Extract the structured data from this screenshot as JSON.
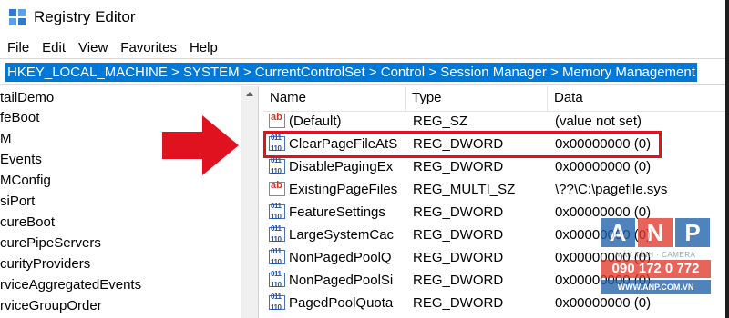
{
  "window": {
    "title": "Registry Editor",
    "icon": "registry-editor-icon"
  },
  "menu": [
    "File",
    "Edit",
    "View",
    "Favorites",
    "Help"
  ],
  "address": "HKEY_LOCAL_MACHINE > SYSTEM > CurrentControlSet > Control > Session Manager > Memory Management",
  "tree": [
    "tailDemo",
    "feBoot",
    "M",
    "Events",
    "MConfig",
    "siPort",
    "cureBoot",
    "curePipeServers",
    "curityProviders",
    "rviceAggregatedEvents",
    "rviceGroupOrder"
  ],
  "list": {
    "headers": {
      "name": "Name",
      "type": "Type",
      "data": "Data"
    },
    "rows": [
      {
        "icon": "string-value-icon",
        "name": "(Default)",
        "type": "REG_SZ",
        "data": "(value not set)"
      },
      {
        "icon": "dword-value-icon",
        "name": "ClearPageFileAtS",
        "type": "REG_DWORD",
        "data": "0x00000000 (0)"
      },
      {
        "icon": "dword-value-icon",
        "name": "DisablePagingEx",
        "type": "REG_DWORD",
        "data": "0x00000000 (0)"
      },
      {
        "icon": "string-value-icon",
        "name": "ExistingPageFiles",
        "type": "REG_MULTI_SZ",
        "data": "\\??\\C:\\pagefile.sys"
      },
      {
        "icon": "dword-value-icon",
        "name": "FeatureSettings",
        "type": "REG_DWORD",
        "data": "0x00000000 (0)"
      },
      {
        "icon": "dword-value-icon",
        "name": "LargeSystemCac",
        "type": "REG_DWORD",
        "data": "0x00000000 (0)"
      },
      {
        "icon": "dword-value-icon",
        "name": "NonPagedPoolQ",
        "type": "REG_DWORD",
        "data": "0x00000000 (0)"
      },
      {
        "icon": "dword-value-icon",
        "name": "NonPagedPoolSi",
        "type": "REG_DWORD",
        "data": "0x00000000 (0)"
      },
      {
        "icon": "dword-value-icon",
        "name": "PagedPoolQuota",
        "type": "REG_DWORD",
        "data": "0x00000000 (0)"
      }
    ]
  },
  "icon_glyphs": {
    "string": "ab",
    "dword": "011 110"
  },
  "annotation": {
    "arrow_color": "#e0121f",
    "box_color": "#e0121f"
  },
  "watermark": {
    "letters": [
      "A",
      "N",
      "P"
    ],
    "colors": [
      "#1f5fa8",
      "#e0392b",
      "#1f5fa8"
    ],
    "subtitle": "MÁY TÍNH · CAMERA",
    "phone": "090 172 0 772",
    "url": "WWW.ANP.COM.VN"
  }
}
